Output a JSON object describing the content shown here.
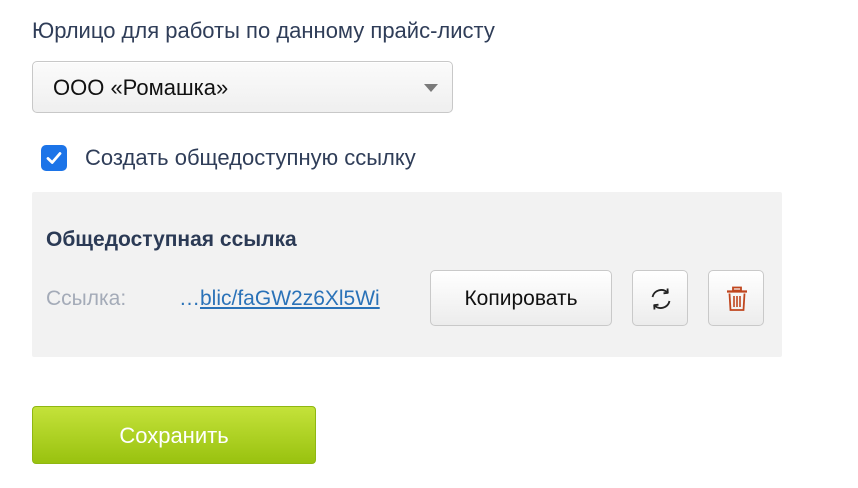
{
  "legal_entity": {
    "label": "Юрлицо для работы по данному прайс-листу",
    "selected": "ООО «Ромашка»"
  },
  "public_link_option": {
    "label": "Создать общедоступную ссылку",
    "checked": true
  },
  "public_link_panel": {
    "title": "Общедоступная ссылка",
    "link_label": "Ссылка:",
    "link_ellipsis": "…",
    "link_text": "blic/faGW2z6Xl5Wi",
    "copy_label": "Копировать",
    "refresh_icon": "refresh-icon",
    "delete_icon": "trash-icon"
  },
  "actions": {
    "save_label": "Сохранить"
  },
  "colors": {
    "checkbox": "#1c74e8",
    "link": "#2a72b8",
    "save_button": "#a8cc1c",
    "trash_icon": "#c0461e"
  }
}
